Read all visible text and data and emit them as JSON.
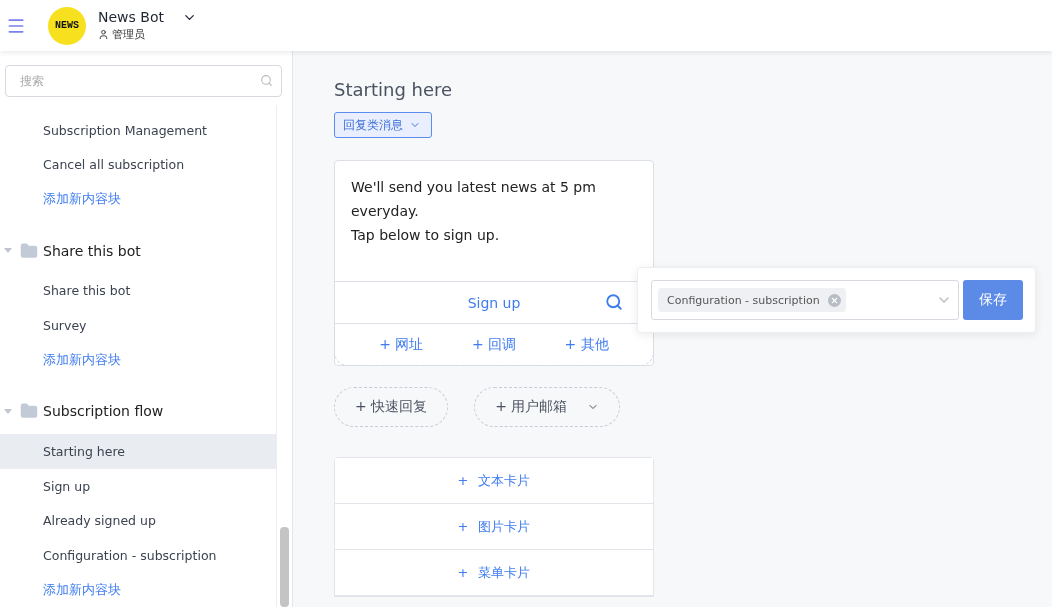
{
  "header": {
    "logo_text": "NEWS",
    "bot_name": "News Bot",
    "role": "管理员"
  },
  "sidebar": {
    "search": {
      "placeholder": "搜索"
    },
    "groups": [
      {
        "items": [
          {
            "label": "Subscription Management",
            "selected": false
          },
          {
            "label": "Cancel all subscription",
            "selected": false
          }
        ],
        "add_label": "添加新内容块"
      },
      {
        "name": "Share this bot",
        "expanded": true,
        "items": [
          {
            "label": "Share this bot",
            "selected": false
          },
          {
            "label": "Survey",
            "selected": false
          }
        ],
        "add_label": "添加新内容块"
      },
      {
        "name": "Subscription flow",
        "expanded": true,
        "items": [
          {
            "label": "Starting here",
            "selected": true
          },
          {
            "label": "Sign up",
            "selected": false
          },
          {
            "label": "Already signed up",
            "selected": false
          },
          {
            "label": "Configuration - subscription",
            "selected": false
          }
        ],
        "add_label": "添加新内容块"
      }
    ]
  },
  "main": {
    "title": "Starting here",
    "type_dropdown": "回复类消息",
    "text_card": {
      "lines": [
        "We'll send you latest news at 5 pm everyday.",
        "Tap below to sign up."
      ],
      "button": "Sign up",
      "add_options": [
        "+ 网址",
        "+ 回调",
        "+ 其他"
      ]
    },
    "quick_replies": [
      {
        "label": "+ 快速回复",
        "kind": "plain"
      },
      {
        "label": "+ 用户邮箱",
        "kind": "dropdown"
      }
    ],
    "add_cards": [
      {
        "plus": "+",
        "label": "文本卡片"
      },
      {
        "plus": "+",
        "label": "图片卡片"
      },
      {
        "plus": "+",
        "label": "菜单卡片"
      }
    ],
    "popover": {
      "tag": "Configuration - subscription",
      "save": "保存"
    }
  }
}
